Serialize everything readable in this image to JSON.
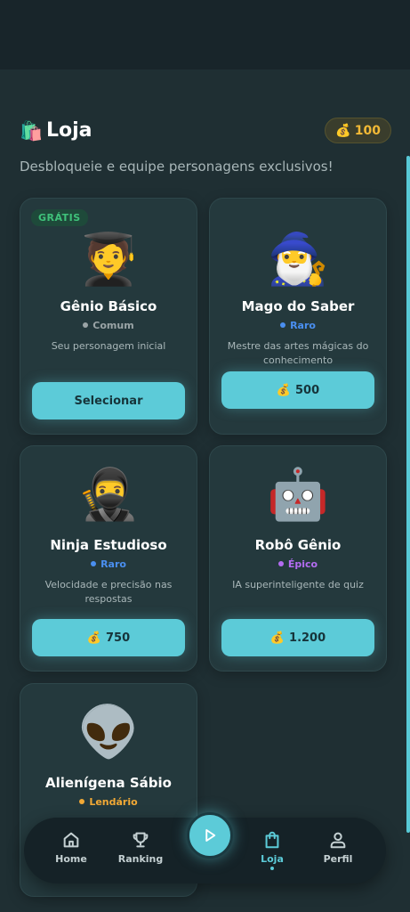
{
  "header": {
    "shop_icon": "🛍️",
    "title": "Loja",
    "coins_icon": "💰",
    "coins": "100"
  },
  "subtitle": "Desbloqueie e equipe personagens exclusivos!",
  "colors": {
    "accent": "#5ccbd8",
    "gold": "#f2b936",
    "comum": "#9aa4a6",
    "raro": "#4a8ff0",
    "epico": "#b46cf2",
    "lendario": "#f2a935"
  },
  "characters": [
    {
      "tag": "GRÁTIS",
      "emoji": "🧑‍🎓",
      "name": "Gênio Básico",
      "rarity": "Comum",
      "description": "Seu personagem inicial",
      "button": "Selecionar"
    },
    {
      "emoji": "🧙‍♂️",
      "name": "Mago do Saber",
      "rarity": "Raro",
      "description": "Mestre das artes mágicas do conhecimento",
      "price_icon": "💰",
      "price": "500"
    },
    {
      "emoji": "🥷",
      "name": "Ninja Estudioso",
      "rarity": "Raro",
      "description": "Velocidade e precisão nas respostas",
      "price_icon": "💰",
      "price": "750"
    },
    {
      "emoji": "🤖",
      "name": "Robô Gênio",
      "rarity": "Épico",
      "description": "IA superinteligente de quiz",
      "price_icon": "💰",
      "price": "1.200"
    },
    {
      "emoji": "👽",
      "name": "Alienígena Sábio",
      "rarity": "Lendário"
    }
  ],
  "nav": {
    "items": [
      {
        "label": "Home",
        "icon": "home-icon"
      },
      {
        "label": "Ranking",
        "icon": "trophy-icon"
      },
      {
        "label": "Loja",
        "icon": "shopping-bag-icon",
        "active": true
      },
      {
        "label": "Perfil",
        "icon": "user-icon"
      }
    ],
    "play_icon": "play-icon"
  }
}
